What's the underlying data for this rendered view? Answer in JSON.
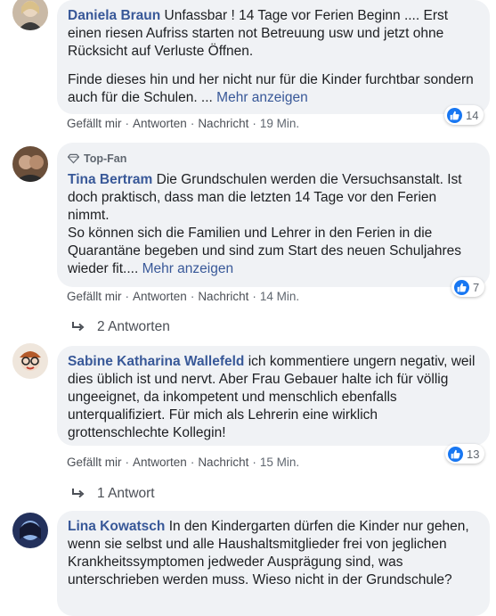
{
  "comments": [
    {
      "author": "Daniela Braun",
      "text_parts": [
        "Unfassbar ! 14 Tage vor Ferien Beginn .... Erst einen riesen Aufriss starten not Betreuung usw und jetzt ohne Rücksicht auf Verluste Öffnen.",
        "Finde dieses hin und her nicht nur für die Kinder furchtbar sondern auch für die Schulen. ..."
      ],
      "more": "Mehr anzeigen",
      "actions": {
        "like": "Gefällt mir",
        "reply": "Antworten",
        "message": "Nachricht",
        "time": "19 Min."
      },
      "reaction_count": "14"
    },
    {
      "badge": "Top-Fan",
      "author": "Tina Bertram",
      "text_parts": [
        "Die Grundschulen werden die Versuchsanstalt. Ist doch praktisch, dass man die letzten 14 Tage vor den Ferien nimmt.",
        "So können sich die Familien und Lehrer in den Ferien in die Quarantäne begeben und sind zum Start des neuen Schuljahres wieder fit...."
      ],
      "more": "Mehr anzeigen",
      "actions": {
        "like": "Gefällt mir",
        "reply": "Antworten",
        "message": "Nachricht",
        "time": "14 Min."
      },
      "reaction_count": "7",
      "replies": "2 Antworten"
    },
    {
      "author": "Sabine Katharina Wallefeld",
      "text": "ich kommentiere ungern negativ, weil dies üblich ist und nervt. Aber Frau Gebauer halte ich für völlig ungeeignet, da inkompetent und menschlich ebenfalls unterqualifiziert. Für mich als Lehrerin eine wirklich grottenschlechte Kollegin!",
      "actions": {
        "like": "Gefällt mir",
        "reply": "Antworten",
        "message": "Nachricht",
        "time": "15 Min."
      },
      "reaction_count": "13",
      "replies": "1 Antwort"
    },
    {
      "author": "Lina Kowatsch",
      "text": "In den Kindergarten dürfen die Kinder nur gehen, wenn sie selbst und alle Haushaltsmitglieder frei von jeglichen Krankheitssymptomen jedweder Ausprägung sind, was unterschrieben werden muss. Wieso nicht in der Grundschule?"
    }
  ],
  "colors": {
    "author": "#385898",
    "bubble": "#f0f2f5",
    "like_blue": "#1877f2",
    "meta": "#606770"
  }
}
